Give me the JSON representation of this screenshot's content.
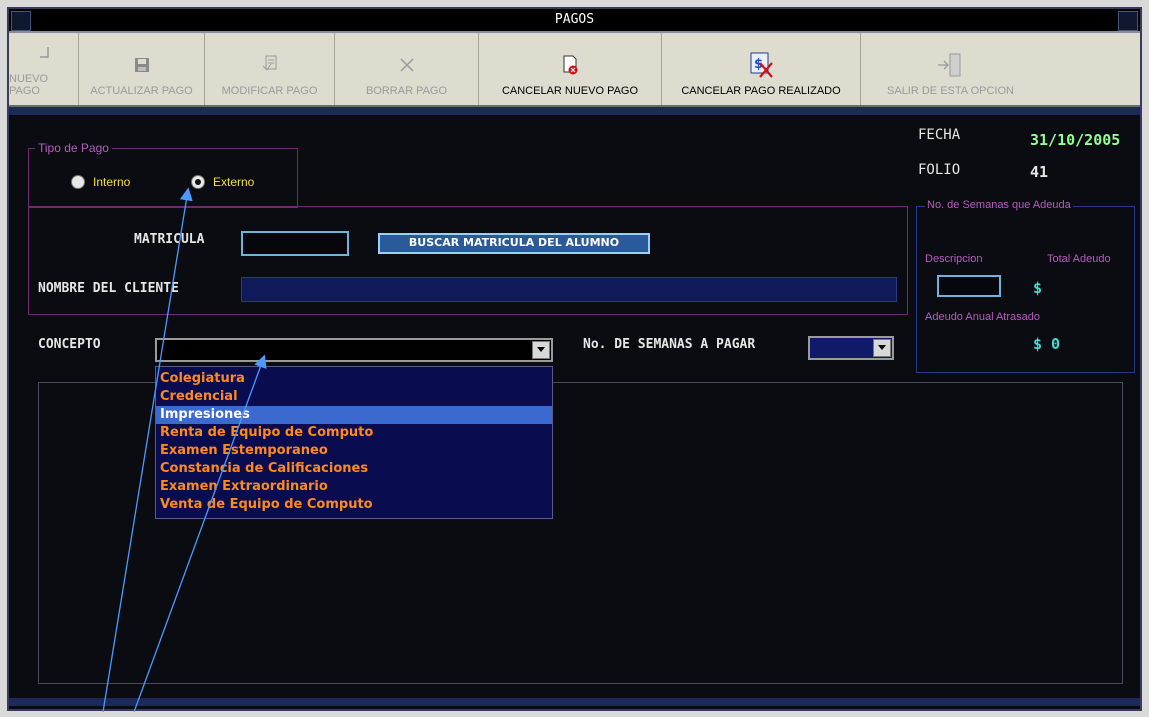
{
  "window": {
    "title": "PAGOS"
  },
  "toolbar": {
    "buttons": [
      {
        "label": "NUEVO PAGO",
        "icon": "new-doc-icon",
        "enabled": false
      },
      {
        "label": "ACTUALIZAR PAGO",
        "icon": "floppy-disk-icon",
        "enabled": false
      },
      {
        "label": "MODIFICAR PAGO",
        "icon": "edit-doc-icon",
        "enabled": false
      },
      {
        "label": "BORRAR PAGO",
        "icon": "x-icon",
        "enabled": false
      },
      {
        "label": "CANCELAR NUEVO PAGO",
        "icon": "cancel-doc-icon",
        "enabled": true
      },
      {
        "label": "CANCELAR PAGO REALIZADO",
        "icon": "cancel-payment-icon",
        "enabled": true
      },
      {
        "label": "SALIR DE ESTA OPCION",
        "icon": "exit-door-icon",
        "enabled": false
      }
    ]
  },
  "tipo_pago": {
    "legend": "Tipo de Pago",
    "options": [
      "Interno",
      "Externo"
    ],
    "selected": "Externo"
  },
  "form": {
    "matricula_label": "MATRICULA",
    "matricula_value": "",
    "buscar_label": "BUSCAR MATRICULA DEL ALUMNO",
    "nombre_label": "NOMBRE DEL CLIENTE",
    "nombre_value": "",
    "concepto_label": "CONCEPTO",
    "concepto_value": "",
    "semanas_label": "No. DE SEMANAS A PAGAR",
    "semanas_value": ""
  },
  "header_info": {
    "fecha_label": "FECHA",
    "fecha_value": "31/10/2005",
    "folio_label": "FOLIO",
    "folio_value": "41"
  },
  "adeudo": {
    "legend": "No. de Semanas que Adeuda",
    "descripcion_label": "Descripcion",
    "total_label": "Total Adeudo",
    "total_value": "$",
    "anual_label": "Adeudo Anual Atrasado",
    "anual_value": "$ 0"
  },
  "concepto_options": [
    "Colegiatura",
    "Credencial",
    "Impresiones",
    "Renta de Equipo de Computo",
    "Examen Estemporaneo",
    "Constancia de Calificaciones",
    "Examen Extraordinario",
    "Venta de Equipo de Computo"
  ],
  "concepto_highlighted": "Impresiones",
  "colors": {
    "background": "#0b0b12",
    "toolbar": "#dedbcf",
    "dropdown_bg": "#0a0c50",
    "dropdown_text": "#ff8a1a",
    "highlight": "#3a6ad0",
    "value_green": "#90ff90",
    "legend_purple": "#b85cc0"
  }
}
